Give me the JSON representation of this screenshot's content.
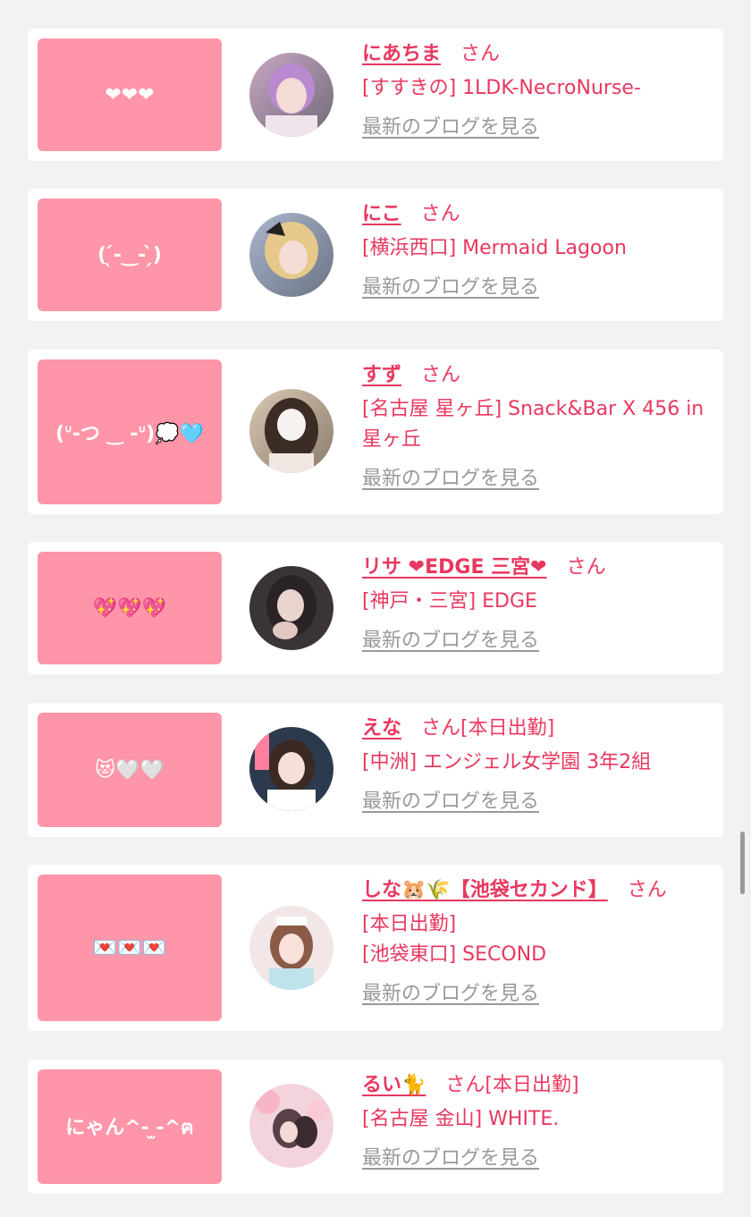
{
  "items": [
    {
      "bubble": "❤❤❤",
      "name": "にあちま",
      "san": "さん",
      "tag": "",
      "shop_lines": [
        "[すすきの] 1LDK-NecroNurse-"
      ],
      "blog": "最新のブログを見る"
    },
    {
      "bubble": "( ̖́-‿- ̗̀)",
      "name": "にこ",
      "san": "さん",
      "tag": "",
      "shop_lines": [
        "[横浜西口] Mermaid Lagoon"
      ],
      "blog": "最新のブログを見る"
    },
    {
      "bubble": "(ᐡ-つ ‿ -ᐡ)💭🩵",
      "name": "すず",
      "san": "さん",
      "tag": "",
      "shop_lines": [
        "[名古屋 星ヶ丘] Snack&Bar X 456 in 星ヶ丘"
      ],
      "blog": "最新のブログを見る"
    },
    {
      "bubble": "💖💖💖",
      "name": "リサ ❤EDGE 三宮❤",
      "san": "さん",
      "tag": "",
      "shop_lines": [
        "[神戸・三宮] EDGE"
      ],
      "blog": "最新のブログを見る"
    },
    {
      "bubble": "😻🤍🤍",
      "name": "えな",
      "san": "さん",
      "tag": "[本日出勤]",
      "shop_lines": [
        "[中洲] エンジェル女学園 3年2組"
      ],
      "blog": "最新のブログを見る"
    },
    {
      "bubble": "💌💌💌",
      "name": "しな🐹🌾【池袋セカンド】",
      "san": "さん",
      "tag": "",
      "shop_lines": [
        "[本日出勤]",
        "[池袋東口] SECOND"
      ],
      "blog": "最新のブログを見る"
    },
    {
      "bubble": "にゃん^- ̫-^ฅ",
      "name": "るい🐈",
      "san": "さん",
      "tag": "[本日出勤]",
      "shop_lines": [
        "[名古屋 金山] WHITE."
      ],
      "blog": "最新のブログを見る"
    }
  ],
  "colors": {
    "bubble": "#ff95a8",
    "name": "#e8385f",
    "link_gray": "#999999",
    "background": "#f2f2f2"
  }
}
